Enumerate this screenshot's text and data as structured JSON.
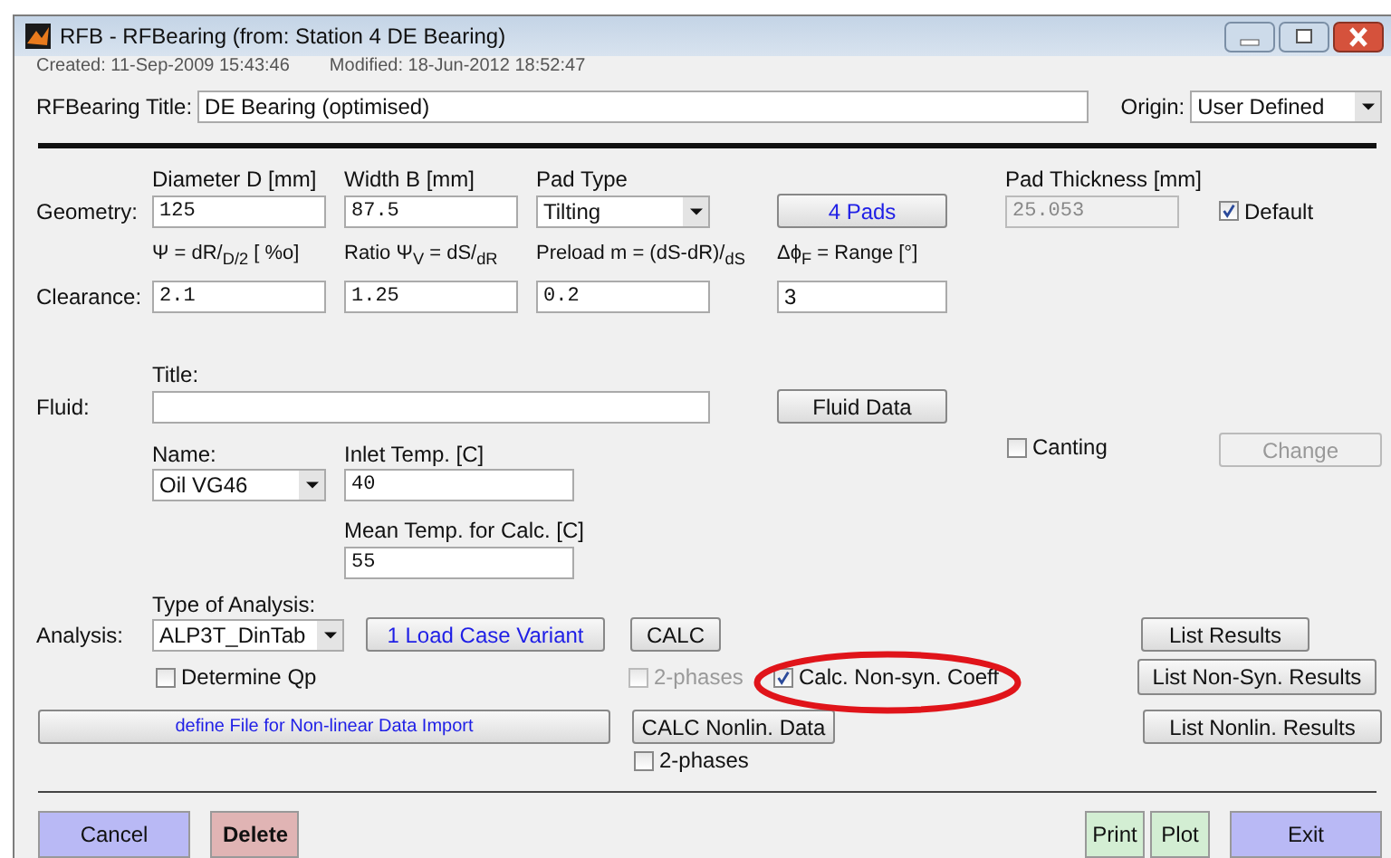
{
  "window": {
    "title": "RFB - RFBearing (from: Station 4 DE Bearing)",
    "created": "Created:  11-Sep-2009 15:43:46",
    "modified": "Modified:  18-Jun-2012 18:52:47"
  },
  "title_row": {
    "label": "RFBearing Title:",
    "value": "DE Bearing (optimised)",
    "origin_label": "Origin:",
    "origin_value": "User Defined"
  },
  "geometry": {
    "label": "Geometry:",
    "fields": [
      {
        "label": "Diameter D [mm]",
        "value": "125",
        "kind": "text"
      },
      {
        "label": "Width B [mm]",
        "value": "87.5",
        "kind": "text"
      },
      {
        "label": "Pad Type",
        "value": "Tilting",
        "kind": "select"
      }
    ],
    "pads_button": "4 Pads",
    "pad_thickness": {
      "label": "Pad Thickness [mm]",
      "value": "25.053",
      "disabled": true
    },
    "default": {
      "label": "Default",
      "checked": true
    }
  },
  "clearance": {
    "label": "Clearance:",
    "fields": [
      {
        "label": "Ψ = dR/$_{D/2}$ [ %o]",
        "value": "2.1",
        "kind": "text"
      },
      {
        "label": "Ratio Ψ$_{V}$ = dS/$_{dR}$",
        "value": "1.25",
        "kind": "text"
      },
      {
        "label": "Preload m = (dS-dR)/$_{dS}$",
        "value": "0.2",
        "kind": "text"
      },
      {
        "label": "Δϕ$_{F}$ = Range [°]",
        "value": "3",
        "kind": "plain"
      }
    ]
  },
  "fluid": {
    "label": "Fluid:",
    "title_label": "Title:",
    "fluid_data_button": "Fluid Data",
    "name_label": "Name:",
    "name_value": "Oil VG46",
    "inlet_label": "Inlet Temp. [C]",
    "inlet_value": "40",
    "mean_label": "Mean Temp. for Calc. [C]",
    "mean_value": "55",
    "canting": {
      "label": "Canting",
      "checked": false
    },
    "change_button": {
      "label": "Change",
      "disabled": true
    }
  },
  "analysis": {
    "label": "Analysis:",
    "type_label": "Type of Analysis:",
    "type_value": "ALP3T_DinTab",
    "load_case_button": "1 Load Case Variant",
    "calc_button": "CALC",
    "calc_two_phases": {
      "label": "2-phases",
      "checked": false,
      "disabled": true
    },
    "non_syn": {
      "label": "Calc. Non-syn. Coeff",
      "checked": true,
      "circled": true
    },
    "determine_qp": {
      "label": "Determine Qp",
      "checked": false
    },
    "define_file_button": "define File for Non-linear Data Import",
    "calc_nonlin_button": "CALC Nonlin. Data",
    "nonlin_two_phases": {
      "label": "2-phases",
      "checked": false,
      "disabled": false
    },
    "list_buttons": [
      "List Results",
      "List Non-Syn. Results",
      "List Nonlin. Results"
    ]
  },
  "footer_buttons": [
    {
      "label": "Cancel",
      "kind": "cancel"
    },
    {
      "label": "Delete",
      "kind": "danger"
    },
    {
      "label": "Print",
      "kind": "aux"
    },
    {
      "label": "Plot",
      "kind": "aux"
    },
    {
      "label": "Exit",
      "kind": "primary"
    }
  ]
}
